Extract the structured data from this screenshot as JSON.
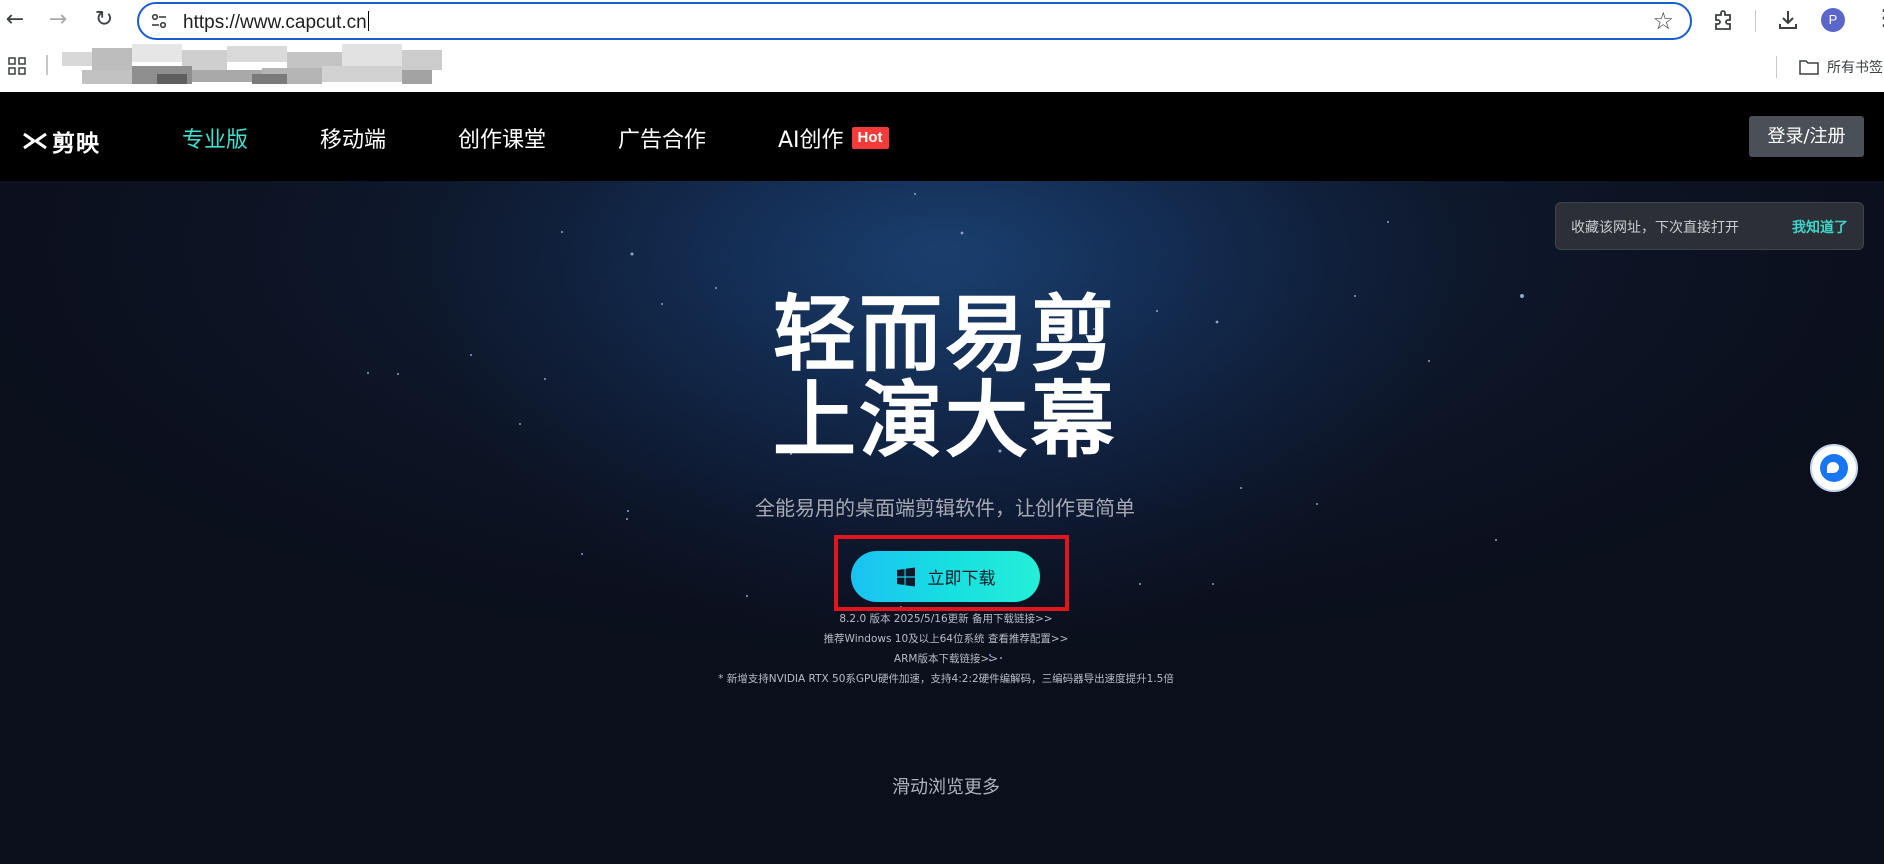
{
  "browser": {
    "url": "https://www.capcut.cn",
    "profile_initial": "P",
    "bookmarks_bar": {
      "all_bookmarks_label": "所有书签"
    }
  },
  "site": {
    "logo_text": "剪映",
    "nav": [
      {
        "label": "专业版",
        "active": true
      },
      {
        "label": "移动端"
      },
      {
        "label": "创作课堂"
      },
      {
        "label": "广告合作"
      },
      {
        "label": "AI创作",
        "badge": "Hot"
      }
    ],
    "login_label": "登录/注册",
    "bookmark_tip": {
      "text": "收藏该网址，下次直接打开",
      "confirm": "我知道了"
    },
    "hero": {
      "headline_line1": "轻而易剪",
      "headline_line2": "上演大幕",
      "subtitle": "全能易用的桌面端剪辑软件，让创作更简单",
      "download_label": "立即下载",
      "version_line": "8.2.0 版本 2025/5/16更新 备用下载链接>>",
      "recommend_line": "推荐Windows 10及以上64位系统 查看推荐配置>>",
      "arm_line": "ARM版本下载链接>>",
      "note_line": "* 新增支持NVIDIA RTX 50系GPU硬件加速，支持4:2:2硬件编解码，三编码器导出速度提升1.5倍"
    },
    "scroll_hint": "滑动浏览更多"
  },
  "colors": {
    "accent": "#3fe0cf",
    "hot_badge": "#f53a3a",
    "download_gradient_start": "#1ac1f2",
    "download_gradient_end": "#25eed7",
    "highlight_box": "#e1161d"
  }
}
